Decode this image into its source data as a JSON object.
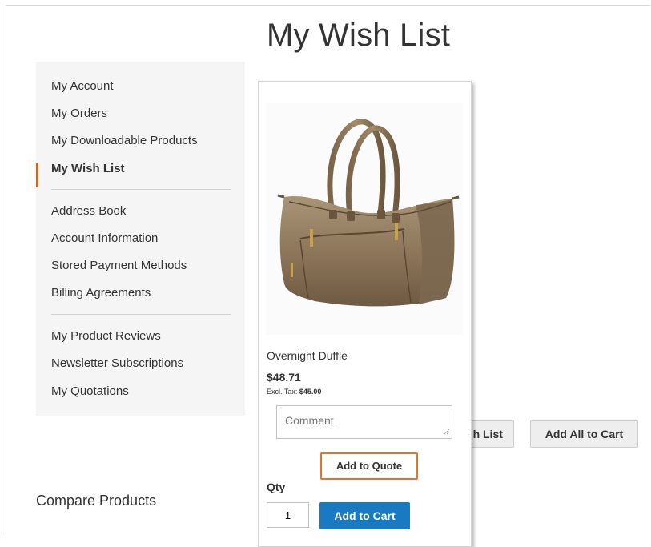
{
  "page": {
    "title": "My Wish List"
  },
  "sidebar": {
    "items": [
      {
        "label": "My Account"
      },
      {
        "label": "My Orders"
      },
      {
        "label": "My Downloadable Products"
      },
      {
        "label": "My Wish List",
        "current": true
      },
      {
        "label": "Address Book"
      },
      {
        "label": "Account Information"
      },
      {
        "label": "Stored Payment Methods"
      },
      {
        "label": "Billing Agreements"
      },
      {
        "label": "My Product Reviews"
      },
      {
        "label": "Newsletter Subscriptions"
      },
      {
        "label": "My Quotations"
      }
    ],
    "accent_color": "#ff5501"
  },
  "product": {
    "name": "Overnight Duffle",
    "price": "$48.71",
    "excl_tax_label": "Excl. Tax:",
    "excl_tax_value": "$45.00",
    "comment_placeholder": "Comment",
    "add_to_quote_label": "Add to Quote",
    "qty_label": "Qty",
    "qty_value": "1",
    "add_to_cart_label": "Add to Cart",
    "image_icon": "duffle-bag-image"
  },
  "toolbar": {
    "share_label": "Share Wish List",
    "add_all_label": "Add All to Cart"
  },
  "compare": {
    "title": "Compare Products"
  },
  "colors": {
    "primary_button": "#1979c3",
    "quote_border": "#e0752f"
  }
}
